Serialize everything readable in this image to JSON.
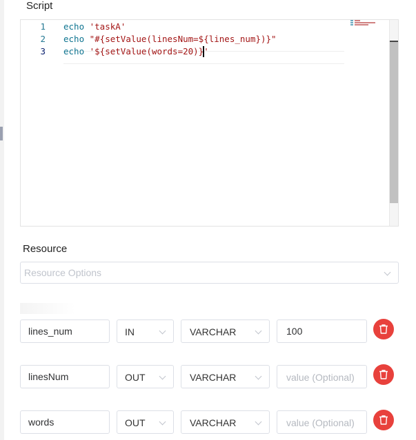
{
  "script_section": {
    "label": "Script",
    "editor": {
      "lines": [
        {
          "number": "1",
          "keyword": "echo",
          "rest": " 'taskA'"
        },
        {
          "number": "2",
          "keyword": "echo",
          "rest": " \"#{setValue(linesNum=${lines_num})}\""
        },
        {
          "number": "3",
          "keyword": "echo",
          "rest": " '${setValue(words=20)}'"
        }
      ]
    }
  },
  "resource_section": {
    "label": "Resource",
    "select_placeholder": "Resource Options"
  },
  "params": [
    {
      "prop": "lines_num",
      "direct": "IN",
      "type": "VARCHAR",
      "value": "100",
      "placeholder": "value (Optional)"
    },
    {
      "prop": "linesNum",
      "direct": "OUT",
      "type": "VARCHAR",
      "value": "",
      "placeholder": "value (Optional)"
    },
    {
      "prop": "words",
      "direct": "OUT",
      "type": "VARCHAR",
      "value": "",
      "placeholder": "value (Optional)"
    }
  ],
  "icons": {
    "delete": "trash-icon",
    "dropdown": "chevron-down-icon"
  },
  "colors": {
    "danger": "#e8413c",
    "keyword": "#0e7490",
    "string": "#a31515",
    "line_number": "#237893"
  }
}
